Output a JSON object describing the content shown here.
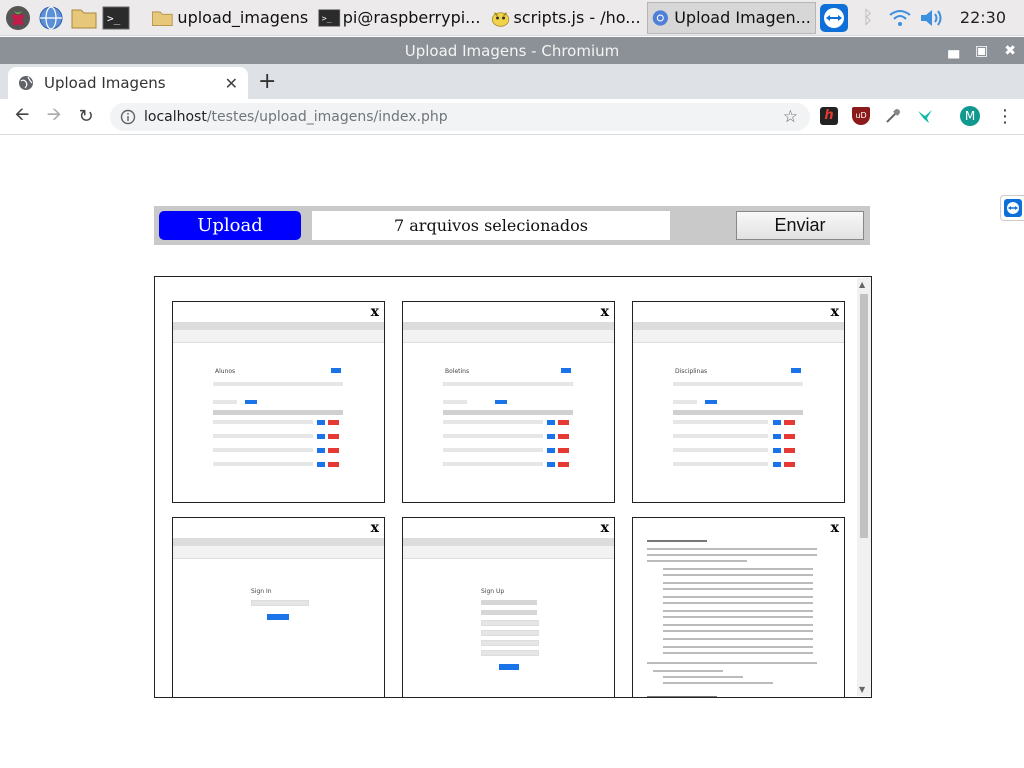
{
  "taskbar": {
    "items": [
      {
        "label": "",
        "icon": "raspberry-icon"
      },
      {
        "label": "",
        "icon": "globe-icon"
      },
      {
        "label": "",
        "icon": "folder-icon"
      },
      {
        "label": "",
        "icon": "terminal-icon"
      },
      {
        "label": "upload_imagens",
        "icon": "folder-icon"
      },
      {
        "label": "pi@raspberrypi...",
        "icon": "terminal-icon"
      },
      {
        "label": "scripts.js - /ho...",
        "icon": "geany-icon"
      },
      {
        "label": "Upload Imagen...",
        "icon": "chromium-icon"
      }
    ],
    "clock": "22:30"
  },
  "window": {
    "title": "Upload Imagens - Chromium"
  },
  "browser": {
    "tab_title": "Upload Imagens",
    "url_host": "localhost",
    "url_path": "/testes/upload_imagens/index.php",
    "profile_initial": "M"
  },
  "page": {
    "upload_label": "Upload",
    "file_count": "7 arquivos selecionados",
    "send_label": "Enviar",
    "close_symbol": "x",
    "thumbnails": [
      {
        "title": "Alunos"
      },
      {
        "title": "Boletins"
      },
      {
        "title": "Disciplinas"
      },
      {
        "title": "Sign In"
      },
      {
        "title": "Sign Up"
      },
      {
        "title": ""
      }
    ]
  },
  "colors": {
    "upload_blue": "#0000ff",
    "titlebar": "#8b9196",
    "taskbar": "#eceaea"
  }
}
